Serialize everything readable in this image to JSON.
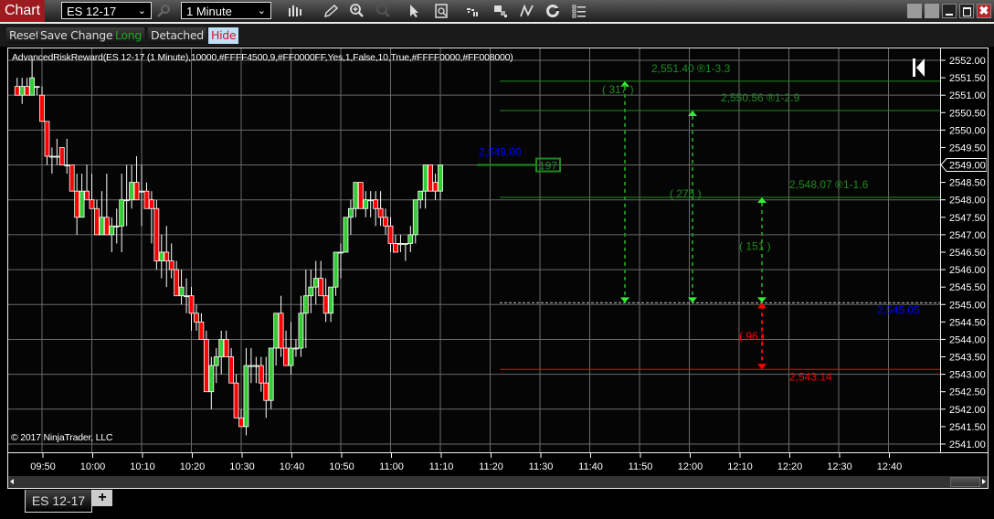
{
  "window": {
    "title_tab": "Chart",
    "instrument": "ES 12-17",
    "interval": "1 Minute",
    "toolbar_icons": [
      "bar-type-icon",
      "drawing-tool-icon",
      "zoom-in-icon",
      "zoom-out-icon",
      "pointer-icon",
      "data-box-icon",
      "chart-trader-icon",
      "templates-icon",
      "strategies-icon",
      "indicators-icon",
      "properties-icon"
    ],
    "window_buttons": [
      "link-button-1",
      "link-button-2",
      "minimize-icon",
      "maximize-icon",
      "close-icon"
    ]
  },
  "toolrow": {
    "reset": "Reset",
    "save_changes": "Save Changes",
    "long": "Long",
    "detached": "Detached",
    "hide": "Hide"
  },
  "indicator_label": "AdvancedRiskReward(ES 12-17 (1 Minute),10000,#FFFF4500,9,#FF0000FF,Yes,1,False,10,True,#FFFF0000,#FF008000)",
  "copyright": "© 2017 NinjaTrader, LLC",
  "colors": {
    "up_candle": "#33cc33",
    "down_candle": "#ff0000",
    "target": "#1f8a1f",
    "stop": "#ff0000",
    "entry": "#0000ff",
    "grid": "#6a6a6a"
  },
  "bottom_tabs": {
    "active": "ES 12-17",
    "add": "+"
  },
  "chart_data": {
    "type": "candlestick",
    "y_ticks": [
      "2552.00",
      "2551.50",
      "2551.00",
      "2550.50",
      "2550.00",
      "2549.50",
      "2549.00",
      "2548.50",
      "2548.00",
      "2547.50",
      "2547.00",
      "2546.50",
      "2546.00",
      "2545.50",
      "2545.00",
      "2544.50",
      "2544.00",
      "2543.50",
      "2543.00",
      "2542.50",
      "2542.00",
      "2541.50",
      "2541.00"
    ],
    "ylim": [
      2540.9,
      2552.2
    ],
    "x_ticks": [
      "09:50",
      "10:00",
      "10:10",
      "10:20",
      "10:30",
      "10:40",
      "10:50",
      "11:00",
      "11:10",
      "11:20",
      "11:30",
      "11:40",
      "11:50",
      "12:00",
      "12:10",
      "12:20",
      "12:30",
      "12:40"
    ],
    "current_price_marker": "2549.00",
    "first_bar_minute": 585,
    "candles": [
      [
        2551.25,
        2551.5,
        2551.0,
        2551.0
      ],
      [
        2551.0,
        2551.5,
        2550.75,
        2551.25
      ],
      [
        2551.25,
        2551.5,
        2551.0,
        2551.0
      ],
      [
        2551.0,
        2552.0,
        2551.0,
        2551.5
      ],
      [
        2551.25,
        2551.25,
        2551.0,
        2551.25
      ],
      [
        2551.0,
        2551.25,
        2550.25,
        2550.25
      ],
      [
        2550.25,
        2550.25,
        2549.0,
        2549.25
      ],
      [
        2549.25,
        2549.5,
        2548.75,
        2549.25
      ],
      [
        2549.25,
        2549.75,
        2549.0,
        2549.25
      ],
      [
        2549.5,
        2549.5,
        2549.0,
        2549.0
      ],
      [
        2549.0,
        2549.75,
        2548.75,
        2549.0
      ],
      [
        2549.0,
        2549.0,
        2548.25,
        2548.25
      ],
      [
        2548.25,
        2548.75,
        2547.0,
        2547.5
      ],
      [
        2547.5,
        2548.75,
        2547.5,
        2548.25
      ],
      [
        2548.25,
        2549.0,
        2548.0,
        2548.0
      ],
      [
        2548.0,
        2548.75,
        2547.75,
        2547.75
      ],
      [
        2547.75,
        2548.0,
        2547.0,
        2547.0
      ],
      [
        2547.0,
        2548.25,
        2547.0,
        2547.5
      ],
      [
        2547.5,
        2548.75,
        2547.25,
        2547.0
      ],
      [
        2547.0,
        2547.5,
        2546.5,
        2547.25
      ],
      [
        2547.25,
        2547.75,
        2546.75,
        2547.25
      ],
      [
        2547.25,
        2548.75,
        2546.5,
        2548.0
      ],
      [
        2548.0,
        2549.0,
        2547.25,
        2548.0
      ],
      [
        2548.0,
        2549.0,
        2547.75,
        2548.5
      ],
      [
        2548.5,
        2549.25,
        2548.25,
        2548.0
      ],
      [
        2548.25,
        2549.0,
        2547.25,
        2548.25
      ],
      [
        2548.25,
        2548.5,
        2548.0,
        2547.75
      ],
      [
        2548.0,
        2548.25,
        2546.75,
        2547.75
      ],
      [
        2547.75,
        2548.0,
        2546.0,
        2546.25
      ],
      [
        2546.25,
        2547.0,
        2545.75,
        2546.5
      ],
      [
        2546.5,
        2547.25,
        2545.5,
        2546.25
      ],
      [
        2546.25,
        2546.75,
        2545.75,
        2546.0
      ],
      [
        2546.0,
        2546.25,
        2545.25,
        2545.25
      ],
      [
        2545.25,
        2546.0,
        2545.0,
        2545.5
      ],
      [
        2545.25,
        2545.75,
        2544.75,
        2545.25
      ],
      [
        2545.25,
        2545.5,
        2544.25,
        2544.75
      ],
      [
        2544.75,
        2545.0,
        2544.25,
        2544.5
      ],
      [
        2544.5,
        2544.75,
        2544.0,
        2544.0
      ],
      [
        2544.0,
        2544.25,
        2542.75,
        2542.5
      ],
      [
        2542.5,
        2543.5,
        2542.0,
        2543.25
      ],
      [
        2543.25,
        2543.75,
        2542.75,
        2543.5
      ],
      [
        2543.5,
        2544.25,
        2543.0,
        2544.0
      ],
      [
        2544.0,
        2544.25,
        2543.5,
        2543.5
      ],
      [
        2543.5,
        2543.75,
        2542.75,
        2542.75
      ],
      [
        2542.75,
        2543.0,
        2541.75,
        2541.75
      ],
      [
        2541.75,
        2542.0,
        2541.5,
        2541.5
      ],
      [
        2541.5,
        2543.75,
        2541.25,
        2543.25
      ],
      [
        2543.25,
        2543.75,
        2542.75,
        2543.25
      ],
      [
        2543.25,
        2543.5,
        2542.75,
        2543.25
      ],
      [
        2543.25,
        2543.5,
        2542.5,
        2542.75
      ],
      [
        2542.75,
        2543.5,
        2541.75,
        2542.25
      ],
      [
        2542.25,
        2543.75,
        2542.0,
        2543.75
      ],
      [
        2543.75,
        2544.25,
        2543.25,
        2544.75
      ],
      [
        2544.75,
        2545.25,
        2543.5,
        2543.75
      ],
      [
        2543.75,
        2544.25,
        2543.25,
        2543.25
      ],
      [
        2543.25,
        2544.5,
        2543.0,
        2543.75
      ],
      [
        2543.75,
        2544.0,
        2543.5,
        2543.75
      ],
      [
        2543.75,
        2545.25,
        2543.5,
        2544.75
      ],
      [
        2544.75,
        2546.0,
        2543.75,
        2545.25
      ],
      [
        2545.25,
        2546.0,
        2544.75,
        2545.5
      ],
      [
        2545.5,
        2546.25,
        2545.0,
        2545.75
      ],
      [
        2545.75,
        2546.25,
        2545.25,
        2545.25
      ],
      [
        2545.25,
        2545.75,
        2544.5,
        2544.75
      ],
      [
        2544.75,
        2545.5,
        2544.5,
        2545.5
      ],
      [
        2545.5,
        2546.5,
        2545.25,
        2546.5
      ],
      [
        2546.5,
        2546.75,
        2545.75,
        2546.5
      ],
      [
        2546.5,
        2547.5,
        2546.5,
        2547.5
      ],
      [
        2547.5,
        2548.0,
        2547.0,
        2547.75
      ],
      [
        2547.75,
        2548.5,
        2547.5,
        2548.5
      ],
      [
        2548.5,
        2548.5,
        2547.75,
        2547.75
      ],
      [
        2547.75,
        2548.25,
        2547.5,
        2548.0
      ],
      [
        2548.0,
        2548.25,
        2547.5,
        2548.0
      ],
      [
        2548.0,
        2548.25,
        2547.25,
        2547.75
      ],
      [
        2547.75,
        2548.25,
        2547.25,
        2547.5
      ],
      [
        2547.5,
        2547.75,
        2547.0,
        2547.25
      ],
      [
        2547.25,
        2547.5,
        2546.5,
        2546.75
      ],
      [
        2546.75,
        2547.0,
        2546.5,
        2546.5
      ],
      [
        2546.75,
        2547.0,
        2546.5,
        2546.75
      ],
      [
        2546.75,
        2546.75,
        2546.25,
        2546.75
      ],
      [
        2546.75,
        2547.25,
        2546.5,
        2547.0
      ],
      [
        2547.0,
        2548.0,
        2546.75,
        2548.0
      ],
      [
        2548.0,
        2548.25,
        2547.75,
        2548.25
      ],
      [
        2548.25,
        2549.0,
        2547.75,
        2549.0
      ],
      [
        2549.0,
        2549.0,
        2548.5,
        2548.25
      ],
      [
        2548.5,
        2548.75,
        2548.0,
        2548.25
      ],
      [
        2548.25,
        2549.0,
        2548.0,
        2549.0
      ]
    ],
    "risk_reward": {
      "entry": {
        "price": 2545.05,
        "label": "2,545.05"
      },
      "stop": {
        "price": 2543.14,
        "label": "2,543.14",
        "ticks_label": "( 96 )"
      },
      "targets": [
        {
          "price": 2548.07,
          "label": "2,548.07  ®1-1.6",
          "ticks_label": "( 151 )",
          "arrow_time": "12:10"
        },
        {
          "price": 2550.56,
          "label": "2,550.56  ®1-2.9",
          "ticks_label": "( 275 )",
          "arrow_time": "11:56"
        },
        {
          "price": 2551.4,
          "label": "2,551.40  ®1-3.3",
          "ticks_label": "( 317 )",
          "arrow_time": "11:44"
        }
      ],
      "last_price": {
        "price": 2549.0,
        "label": "2,549.00",
        "box_label": "197"
      }
    }
  }
}
